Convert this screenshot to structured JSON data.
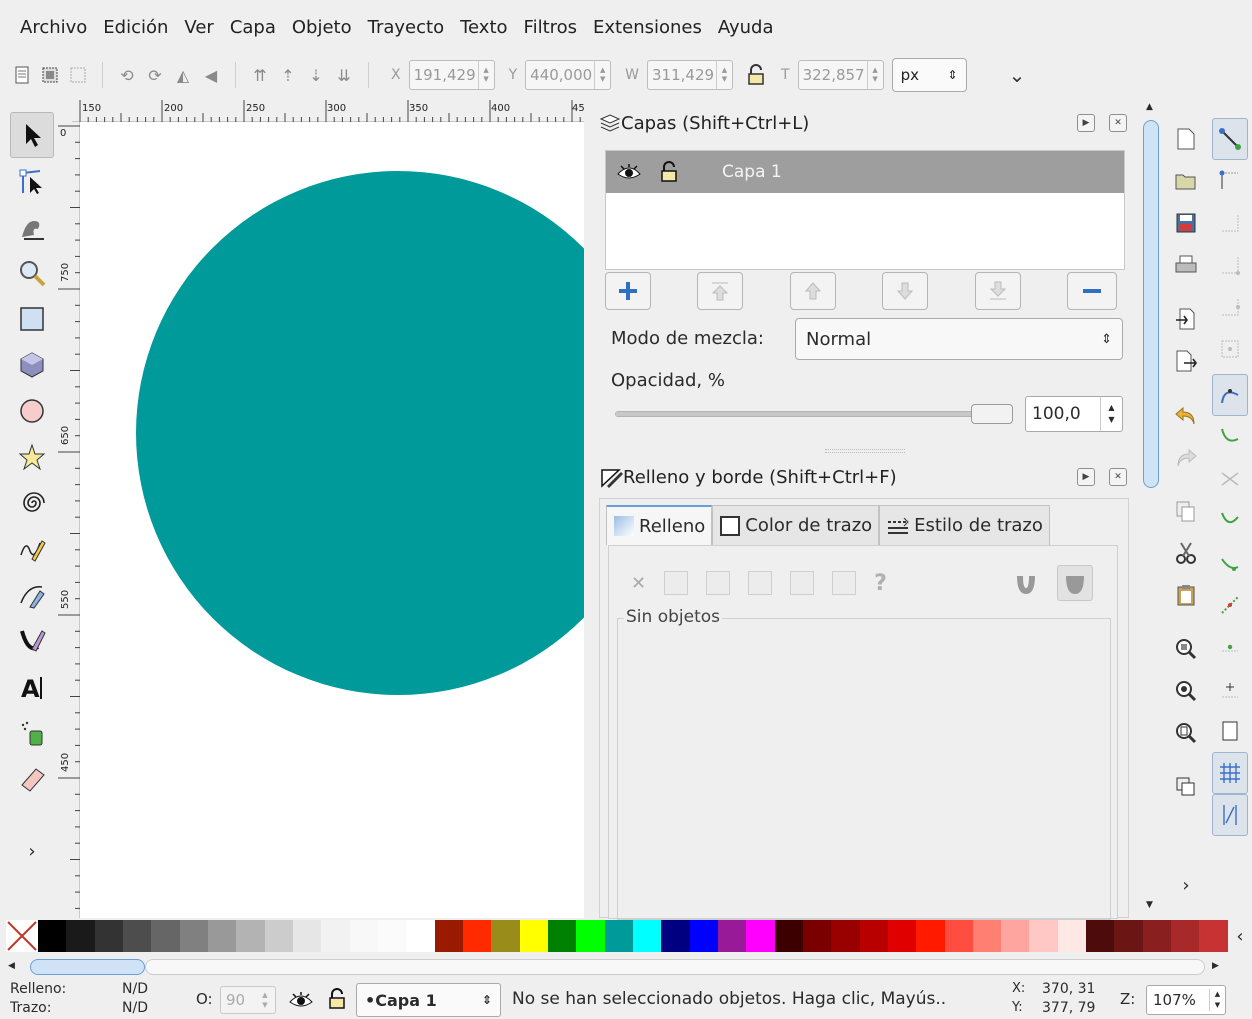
{
  "menu": [
    "Archivo",
    "Edición",
    "Ver",
    "Capa",
    "Objeto",
    "Trayecto",
    "Texto",
    "Filtros",
    "Extensiones",
    "Ayuda"
  ],
  "toolbar": {
    "x_label": "X",
    "x_value": "191,429",
    "y_label": "Y",
    "y_value": "440,000",
    "w_label": "W",
    "w_value": "311,429",
    "h_label": "T",
    "h_value": "322,857",
    "unit": "px",
    "overflow": "⌄"
  },
  "ruler": {
    "h_ticks": [
      "150",
      "200",
      "250",
      "300",
      "350",
      "400",
      "45"
    ],
    "v_ticks": [
      "0",
      "750",
      "650",
      "550",
      "450"
    ]
  },
  "canvas": {
    "circle_color": "#009a9a"
  },
  "layers_panel": {
    "title": "Capas (Shift+Ctrl+L)",
    "layer_name": "Capa 1",
    "blend_label": "Modo de mezcla:",
    "blend_value": "Normal",
    "opacity_label": "Opacidad, %",
    "opacity_value": "100,0",
    "opacity_level": 1.0
  },
  "fill_panel": {
    "title": "Relleno y borde (Shift+Ctrl+F)",
    "tabs": [
      "Relleno",
      "Color de trazo",
      "Estilo de trazo"
    ],
    "group_label": "Sin objetos"
  },
  "palette": [
    "#000000",
    "#1a1a1a",
    "#333333",
    "#4d4d4d",
    "#666666",
    "#808080",
    "#999999",
    "#b3b3b3",
    "#cccccc",
    "#e6e6e6",
    "#f2f2f2",
    "#f8f8f8",
    "#fbfbfb",
    "#ffffff",
    "#991a00",
    "#ff2a00",
    "#998c1a",
    "#ffff00",
    "#008000",
    "#00ff00",
    "#009a9a",
    "#00ffff",
    "#000080",
    "#0000ff",
    "#991a99",
    "#ff00ff",
    "#3d0000",
    "#7a0000",
    "#990000",
    "#b80000",
    "#e00000",
    "#ff1a00",
    "#ff4d40",
    "#ff7f73",
    "#ffa59f",
    "#ffc8c4",
    "#ffe8e6",
    "#4d0b0b",
    "#6b1515",
    "#8a1f1f",
    "#a82929",
    "#c73333"
  ],
  "statusbar": {
    "fill_label": "Relleno:",
    "fill_value": "N/D",
    "stroke_label": "Trazo:",
    "stroke_value": "N/D",
    "opacity_label": "O:",
    "opacity_value": "90",
    "layer": "•Capa 1",
    "message": "No se han seleccionado objetos. Haga clic, Mayús..",
    "x_label": "X:",
    "x_value": "370, 31",
    "y_label": "Y:",
    "y_value": "377, 79",
    "zoom_label": "Z:",
    "zoom_value": "107%"
  }
}
